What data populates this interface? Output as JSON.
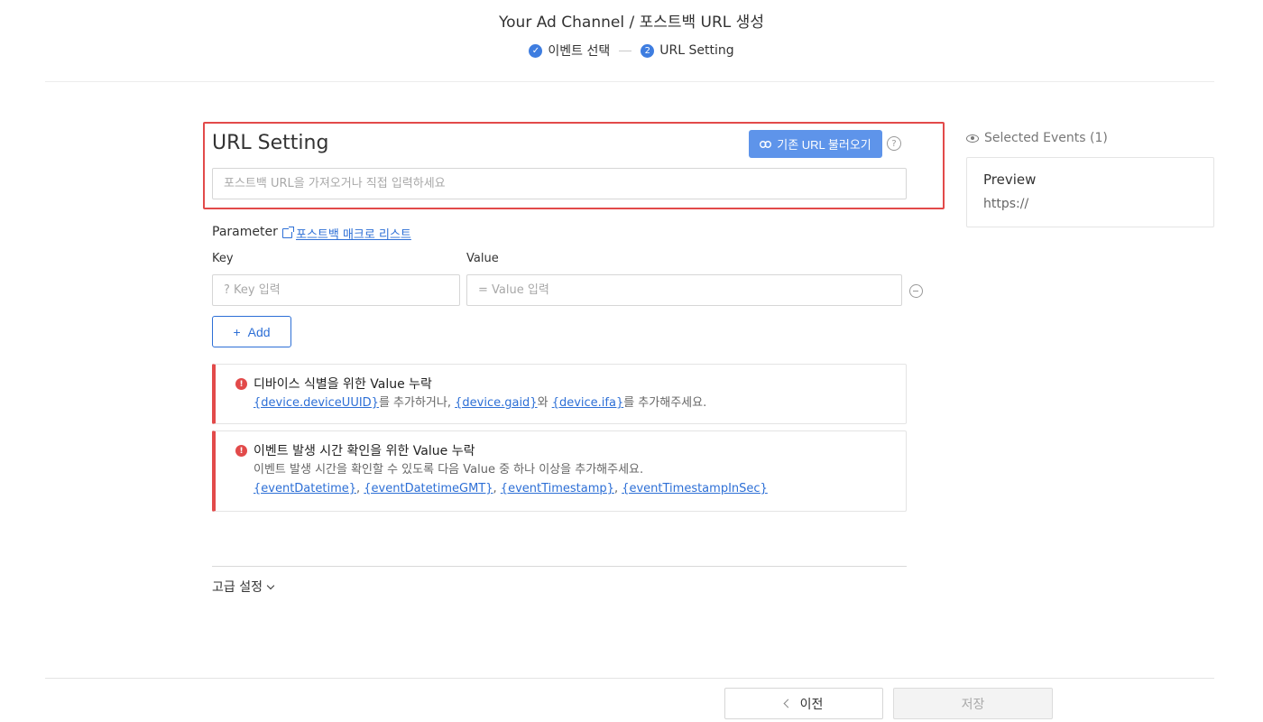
{
  "header": {
    "channel": "Your Ad Channel",
    "separator": "/",
    "title": "포스트백 URL 생성",
    "steps": [
      {
        "label": "이벤트 선택",
        "state": "done",
        "mark": "✓"
      },
      {
        "label": "URL Setting",
        "state": "current",
        "mark": "2"
      }
    ]
  },
  "url_setting": {
    "title": "URL Setting",
    "load_button": "기존 URL 불러오기",
    "help": "?",
    "input_placeholder": "포스트백 URL을 가져오거나 직접 입력하세요"
  },
  "parameter": {
    "label": "Parameter",
    "macro_link": "포스트백 매크로 리스트",
    "key_label": "Key",
    "value_label": "Value",
    "key_placeholder": "? Key 입력",
    "value_placeholder": "= Value 입력",
    "add_button": "Add",
    "add_icon": "+"
  },
  "alerts": [
    {
      "title": "디바이스 식별을 위한 Value 누락",
      "parts": [
        "{device.deviceUUID}",
        "를 추가하거나, ",
        "{device.gaid}",
        "와 ",
        "{device.ifa}",
        "를 추가해주세요."
      ]
    },
    {
      "title": "이벤트 발생 시간 확인을 위한 Value 누락",
      "text": "이벤트 발생 시간을 확인할 수 있도록 다음 Value 중 하나 이상을 추가해주세요.",
      "macros": [
        "{eventDatetime}",
        ", ",
        "{eventDatetimeGMT}",
        ", ",
        "{eventTimestamp}",
        ", ",
        "{eventTimestampInSec}"
      ]
    }
  ],
  "advanced": {
    "label": "고급 설정"
  },
  "sidebar": {
    "selected_events": "Selected Events (1)",
    "preview_title": "Preview",
    "preview_url": "https://"
  },
  "footer": {
    "prev_button": "이전",
    "save_button": "저장"
  },
  "colors": {
    "accent": "#3e7de0",
    "link": "#2d6fd6",
    "error": "#e24a4a"
  }
}
